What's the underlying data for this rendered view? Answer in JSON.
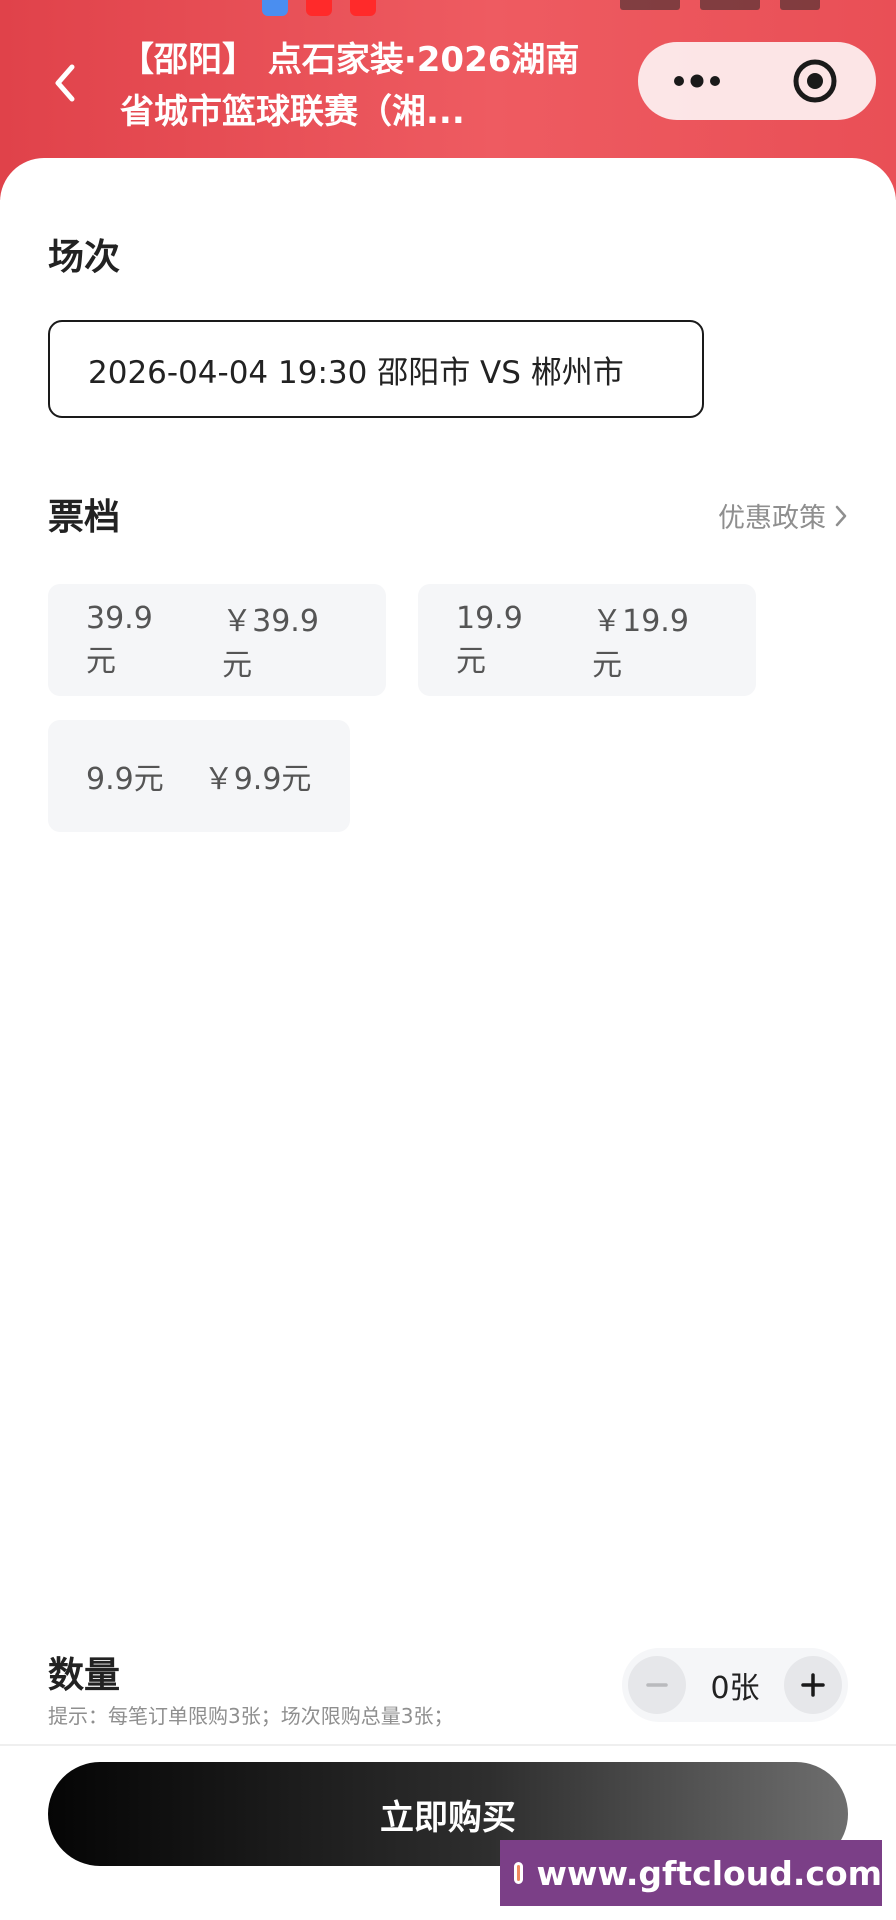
{
  "header": {
    "title": "【邵阳】 点石家装·2026湖南省城市篮球联赛（湘..."
  },
  "session": {
    "label": "场次",
    "selected": "2026-04-04 19:30 邵阳市 VS 郴州市"
  },
  "tiers": {
    "label": "票档",
    "policy_link": "优惠政策",
    "items": [
      {
        "name": "39.9元",
        "price": "￥39.9元"
      },
      {
        "name": "19.9元",
        "price": "￥19.9元"
      },
      {
        "name": "9.9元",
        "price": "￥9.9元"
      }
    ]
  },
  "quantity": {
    "label": "数量",
    "hint": "提示：每笔订单限购3张；场次限购总量3张；",
    "value": "0张"
  },
  "buy_button": {
    "label": "立即购买"
  },
  "watermark": {
    "text": "www.gftcloud.com"
  },
  "colors": {
    "header_accent": "#e94f56",
    "buy_button": "#000000",
    "tier_bg": "#f5f6f8"
  }
}
